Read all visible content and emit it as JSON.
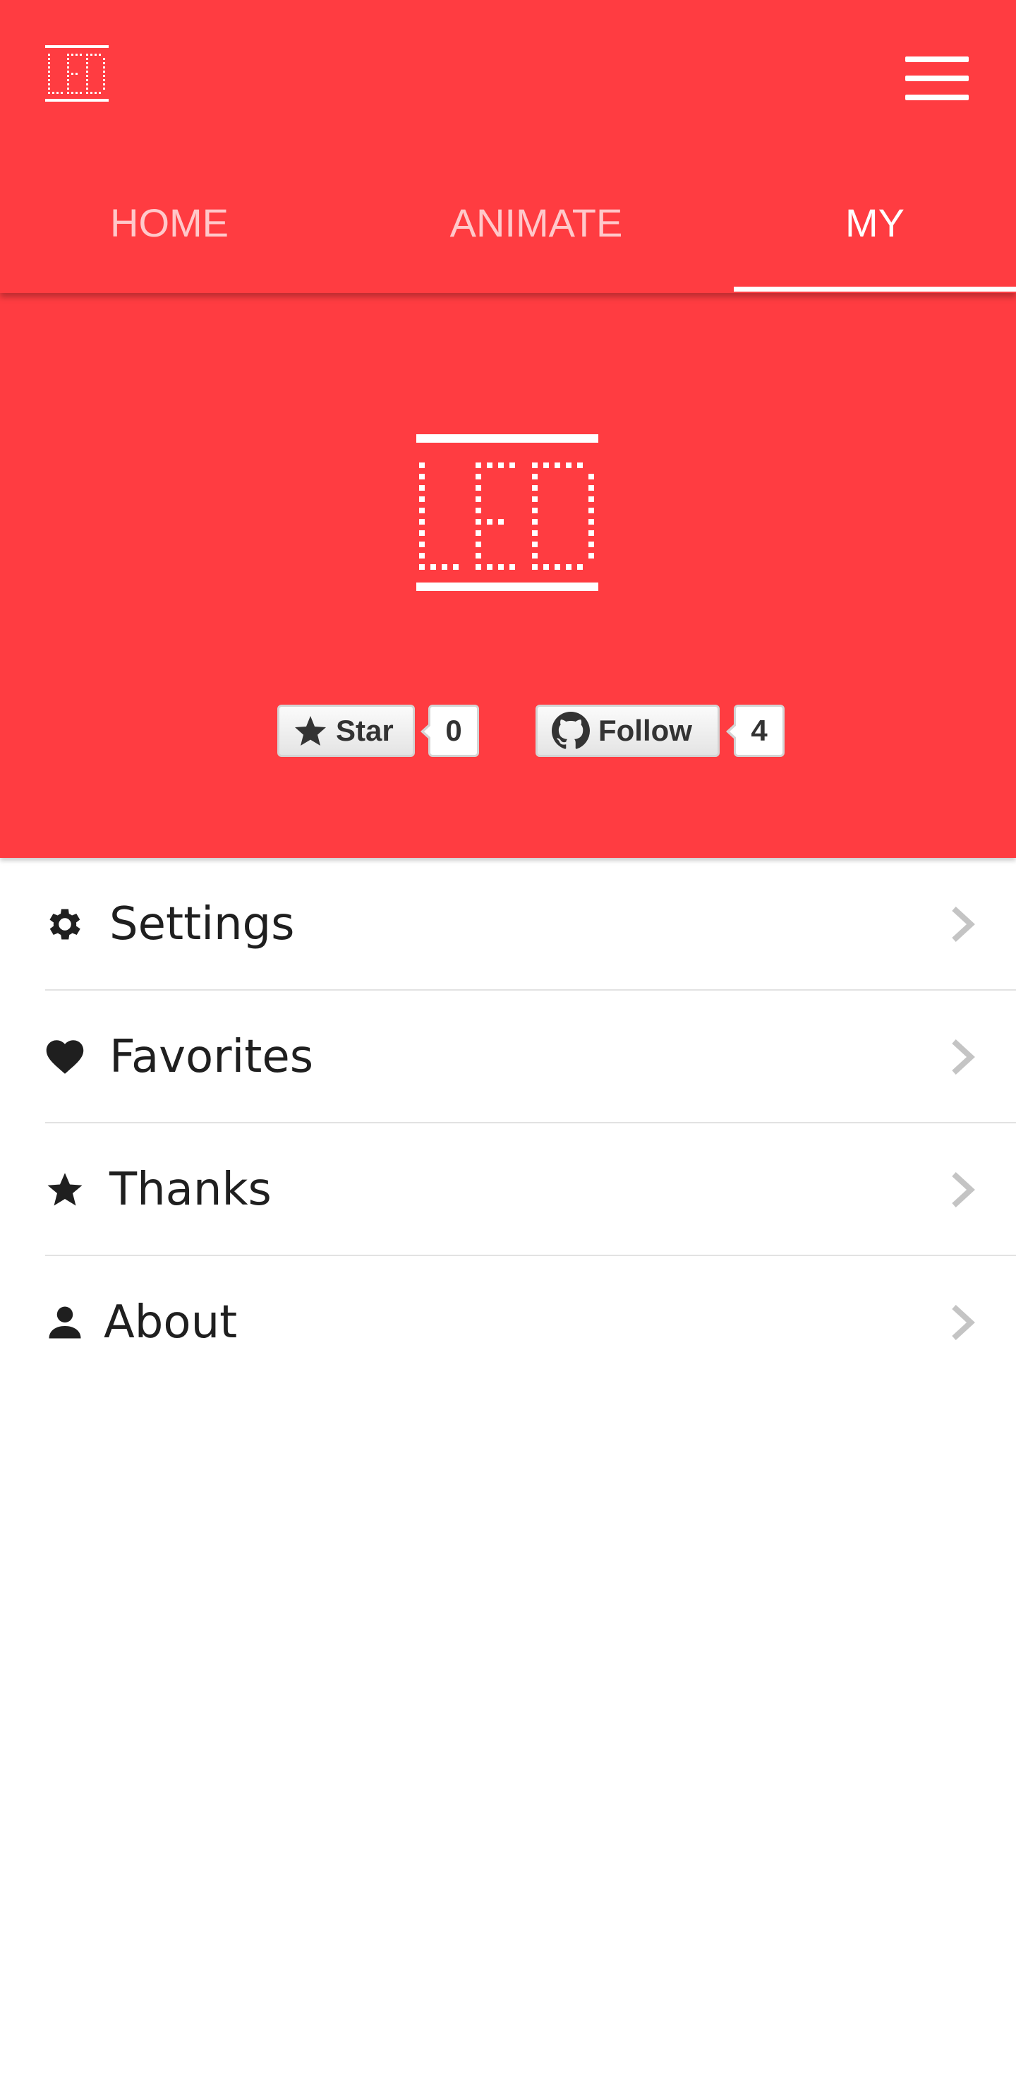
{
  "header": {
    "logo": "LED",
    "tabs": [
      {
        "label": "HOME"
      },
      {
        "label": "ANIMATE"
      },
      {
        "label": "MY"
      }
    ],
    "active_tab": "MY"
  },
  "hero": {
    "logo": "LED",
    "star_button": {
      "label": "Star",
      "count": "0"
    },
    "follow_button": {
      "label": "Follow",
      "count": "4"
    }
  },
  "menu": {
    "items": [
      {
        "label": "Settings",
        "icon": "gear-icon"
      },
      {
        "label": "Favorites",
        "icon": "heart-icon"
      },
      {
        "label": "Thanks",
        "icon": "star-icon"
      },
      {
        "label": "About",
        "icon": "user-icon"
      }
    ]
  },
  "colors": {
    "accent": "#ff3c41",
    "text": "#1f1f1f",
    "chevron": "#c4c4c4"
  }
}
